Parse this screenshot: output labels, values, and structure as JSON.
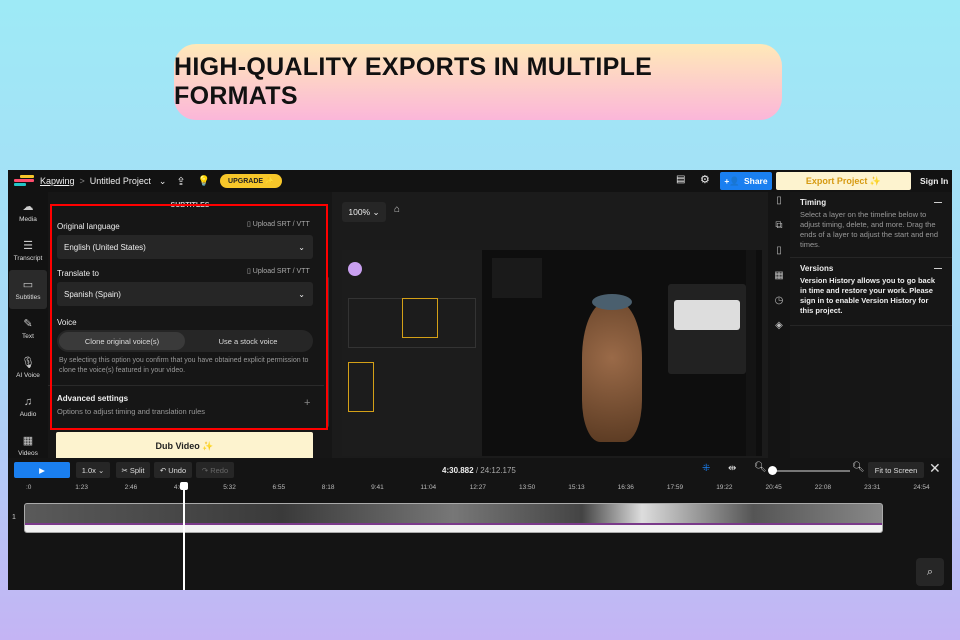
{
  "banner": {
    "title": "HIGH-QUALITY EXPORTS IN MULTIPLE FORMATS"
  },
  "topbar": {
    "brand": "Kapwing",
    "separator": ">",
    "project": "Untitled Project",
    "upgrade": "UPGRADE ✨",
    "share": "Share",
    "export": "Export Project ✨",
    "sign_in": "Sign In"
  },
  "rail": [
    {
      "label": "Media",
      "icon": "☁"
    },
    {
      "label": "Transcript",
      "icon": "☰"
    },
    {
      "label": "Subtitles",
      "icon": "▭"
    },
    {
      "label": "Text",
      "icon": "✎"
    },
    {
      "label": "AI Voice",
      "icon": "🎙"
    },
    {
      "label": "Audio",
      "icon": "♫"
    },
    {
      "label": "Videos",
      "icon": "▦"
    }
  ],
  "panel": {
    "header": "SUBTITLES",
    "original_language_label": "Original language",
    "upload": "Upload SRT / VTT",
    "original_language": "English (United States)",
    "translate_label": "Translate to",
    "translate_to": "Spanish (Spain)",
    "voice_label": "Voice",
    "voice_clone": "Clone original voice(s)",
    "voice_stock": "Use a stock voice",
    "disclaimer": "By selecting this option you confirm that you have obtained explicit permission to clone the voice(s) featured in your video.",
    "advanced_title": "Advanced settings",
    "advanced_desc": "Options to adjust timing and translation rules",
    "dub": "Dub Video ✨"
  },
  "canvas": {
    "zoom": "100%"
  },
  "right": {
    "timing_title": "Timing",
    "timing_text": "Select a layer on the timeline below to adjust timing, delete, and more. Drag the ends of a layer to adjust the start and end times.",
    "versions_title": "Versions",
    "versions_text": "Version History allows you to go back in time and restore your work. Please sign in to enable Version History for this project."
  },
  "timeline": {
    "speed": "1.0x",
    "split": "✂ Split",
    "undo": "↶ Undo",
    "redo": "↷ Redo",
    "current": "4:30.882",
    "total": "/ 24:12.175",
    "fit": "Fit to Screen",
    "track_num": "1",
    "ticks": [
      ":0",
      "1:23",
      "2:46",
      "4:09",
      "5:32",
      "6:55",
      "8:18",
      "9:41",
      "11:04",
      "12:27",
      "13:50",
      "15:13",
      "16:36",
      "17:59",
      "19:22",
      "20:45",
      "22:08",
      "23:31",
      "24:54"
    ]
  },
  "colors": {
    "accent": "#1a7ff0",
    "export_bg": "#fdf3cf",
    "upgrade": "#f7c72a",
    "highlight": "#ff0000"
  }
}
